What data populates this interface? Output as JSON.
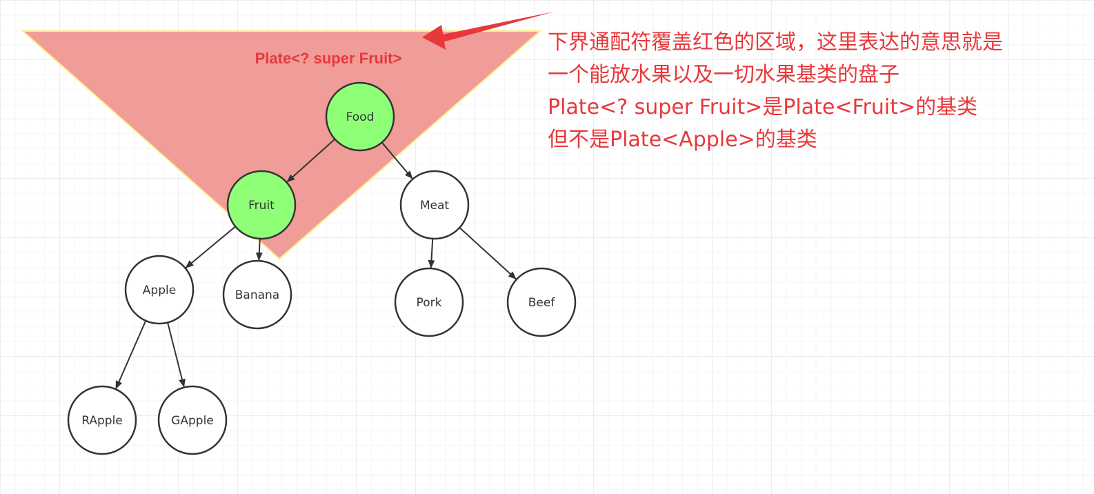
{
  "colors": {
    "region_fill": "#f09c99",
    "region_border": "#ffee88",
    "highlight_node": "#90ff78",
    "node_fill": "#ffffff",
    "node_stroke": "#333333",
    "edge": "#333333",
    "text_red": "#e8383b",
    "arrow_red": "#e8383b"
  },
  "region_label": "Plate<? super Fruit>",
  "annotation": {
    "lines": [
      "下界通配符覆盖红色的区域，这里表达的意思就是",
      "一个能放水果以及一切水果基类的盘子",
      "Plate<? super Fruit>是Plate<Fruit>的基类",
      "但不是Plate<Apple>的基类"
    ]
  },
  "nodes": {
    "food": {
      "label": "Food",
      "highlighted": true
    },
    "fruit": {
      "label": "Fruit",
      "highlighted": true
    },
    "meat": {
      "label": "Meat",
      "highlighted": false
    },
    "apple": {
      "label": "Apple",
      "highlighted": false
    },
    "banana": {
      "label": "Banana",
      "highlighted": false
    },
    "pork": {
      "label": "Pork",
      "highlighted": false
    },
    "beef": {
      "label": "Beef",
      "highlighted": false
    },
    "rapple": {
      "label": "RApple",
      "highlighted": false
    },
    "gapple": {
      "label": "GApple",
      "highlighted": false
    }
  },
  "edges": [
    [
      "food",
      "fruit"
    ],
    [
      "food",
      "meat"
    ],
    [
      "fruit",
      "apple"
    ],
    [
      "fruit",
      "banana"
    ],
    [
      "meat",
      "pork"
    ],
    [
      "meat",
      "beef"
    ],
    [
      "apple",
      "rapple"
    ],
    [
      "apple",
      "gapple"
    ]
  ]
}
